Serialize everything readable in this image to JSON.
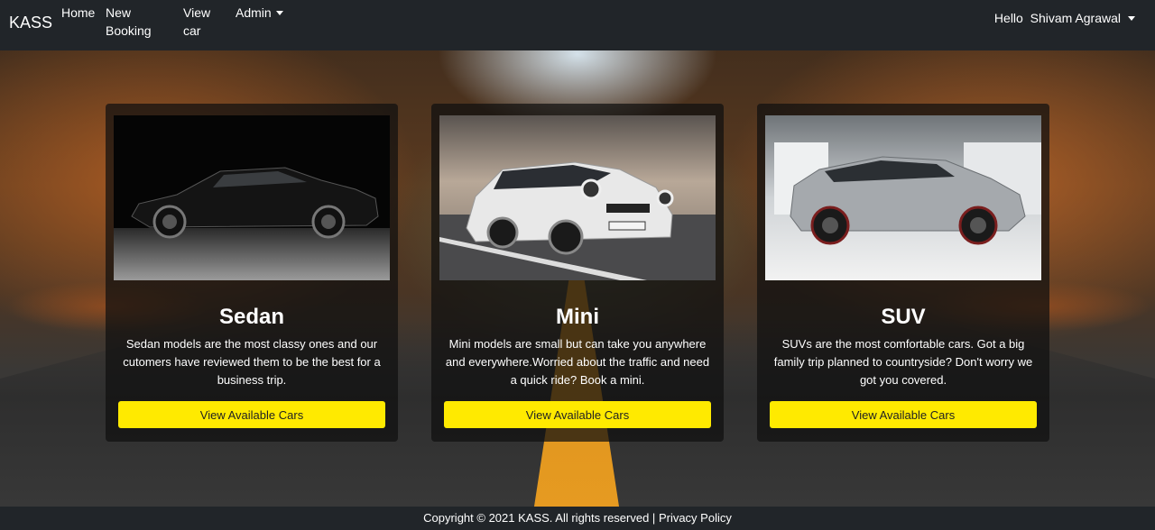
{
  "navbar": {
    "brand": "KASS",
    "links": [
      {
        "label": "Home"
      },
      {
        "label_line1": "New",
        "label_line2": "Booking"
      },
      {
        "label_line1": "View",
        "label_line2": "car"
      },
      {
        "label": "Admin"
      }
    ],
    "greeting": "Hello",
    "user_name": "Shivam Agrawal"
  },
  "cards": [
    {
      "title": "Sedan",
      "description": "Sedan models are the most classy ones and our cutomers have reviewed them to be the best for a business trip.",
      "button": "View Available Cars"
    },
    {
      "title": "Mini",
      "description": "Mini models are small but can take you anywhere and everywhere.Worried about the traffic and need a quick ride? Book a mini.",
      "button": "View Available Cars"
    },
    {
      "title": "SUV",
      "description": "SUVs are the most comfortable cars. Got a big family trip planned to countryside? Don't worry we got you covered.",
      "button": "View Available Cars"
    }
  ],
  "footer": {
    "copyright": "Copyright © 2021 KASS. All rights reserved | ",
    "privacy": "Privacy Policy"
  },
  "colors": {
    "navbar_bg": "#212529",
    "button_bg": "#ffea00",
    "card_bg": "rgba(15,15,15,0.72)"
  }
}
